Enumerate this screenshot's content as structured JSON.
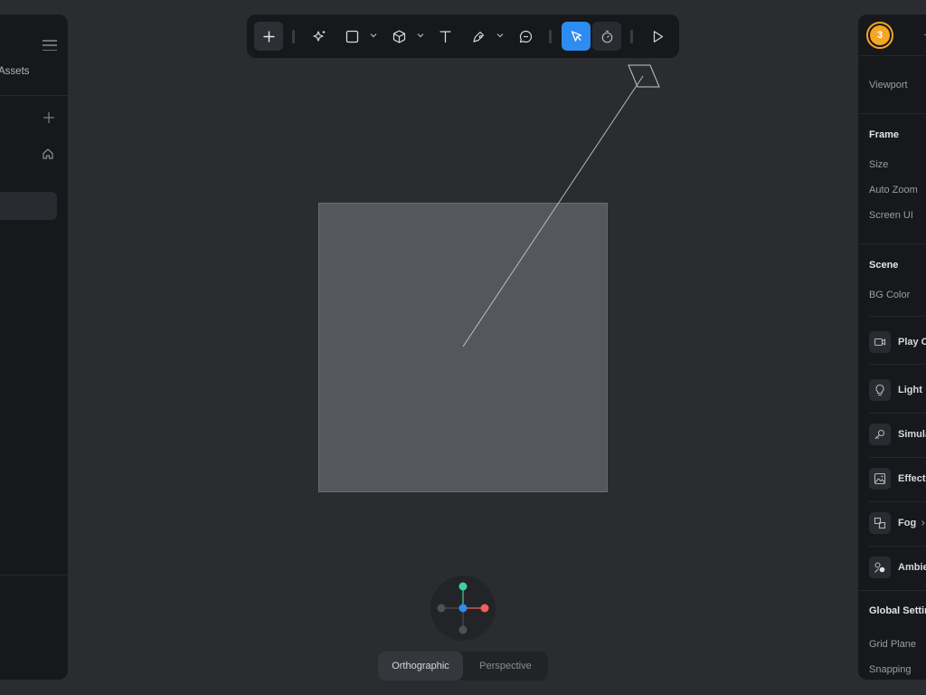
{
  "left_panel": {
    "assets_label": "Assets"
  },
  "toolbar": {
    "tools": [
      "add-icon",
      "ai-sparkle-icon",
      "rectangle-icon",
      "cube-icon",
      "text-icon",
      "pen-icon",
      "comment-icon",
      "select-cursor-icon",
      "timer-icon",
      "play-icon"
    ],
    "accent_color": "#2d8cf0"
  },
  "view_toggle": {
    "orthographic": "Orthographic",
    "perspective": "Perspective",
    "selected": "Orthographic"
  },
  "right_panel": {
    "avatar_count": "3",
    "viewport_label": "Viewport",
    "frame": {
      "heading": "Frame",
      "size_label": "Size",
      "auto_zoom_label": "Auto Zoom",
      "screen_ui_label": "Screen UI"
    },
    "scene": {
      "heading": "Scene",
      "bg_color_label": "BG Color"
    },
    "items": [
      {
        "label": "Play C",
        "icon": "camera-icon"
      },
      {
        "label": "Light",
        "icon": "lightbulb-icon"
      },
      {
        "label": "Simula",
        "icon": "simulation-icon"
      },
      {
        "label": "Effect",
        "icon": "image-effect-icon"
      },
      {
        "label": "Fog",
        "icon": "fog-icon"
      },
      {
        "label": "Ambie",
        "icon": "ambient-icon"
      }
    ],
    "global_settings": {
      "heading": "Global Settin",
      "grid_plane_label": "Grid Plane",
      "snapping_label": "Snapping"
    }
  },
  "gizmo": {
    "axis_colors": {
      "x": "#f0605d",
      "y": "#3ed39a",
      "z": "#2d8cf0"
    }
  }
}
